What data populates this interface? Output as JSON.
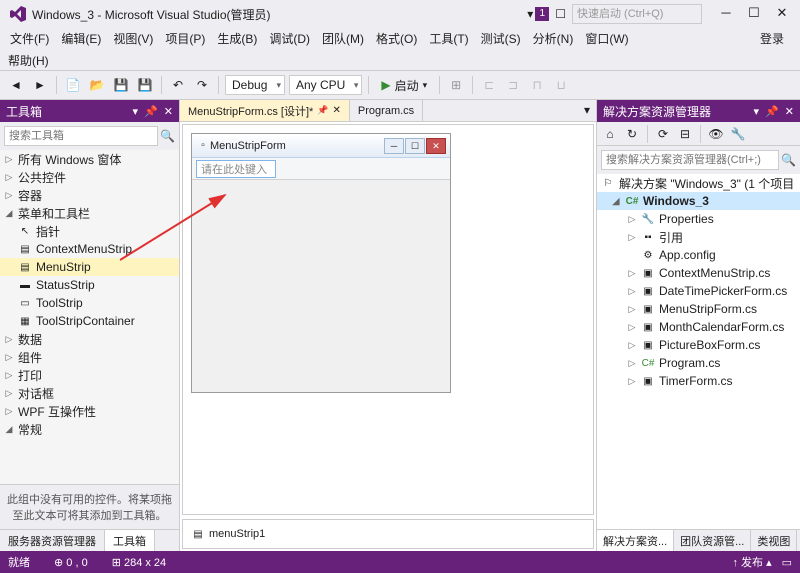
{
  "title": "Windows_3 - Microsoft Visual Studio(管理员)",
  "badge": "1",
  "quicklaunch_placeholder": "快速启动 (Ctrl+Q)",
  "login": "登录",
  "menu": {
    "file": "文件(F)",
    "edit": "编辑(E)",
    "view": "视图(V)",
    "project": "项目(P)",
    "build": "生成(B)",
    "debug": "调试(D)",
    "team": "团队(M)",
    "format": "格式(O)",
    "tools": "工具(T)",
    "test": "测试(S)",
    "analyze": "分析(N)",
    "window": "窗口(W)",
    "help": "帮助(H)"
  },
  "toolbar": {
    "config": "Debug",
    "platform": "Any CPU",
    "start": "启动"
  },
  "toolbox": {
    "title": "工具箱",
    "search_placeholder": "搜索工具箱",
    "groups": {
      "allwin": "所有 Windows 窗体",
      "common": "公共控件",
      "containers": "容器",
      "menus": "菜单和工具栏",
      "data": "数据",
      "components": "组件",
      "printing": "打印",
      "dialogs": "对话框",
      "wpf": "WPF 互操作性",
      "general": "常规"
    },
    "menus_items": {
      "pointer": "指针",
      "context": "ContextMenuStrip",
      "menu": "MenuStrip",
      "status": "StatusStrip",
      "tool": "ToolStrip",
      "container": "ToolStripContainer"
    },
    "note": "此组中没有可用的控件。将某项拖至此文本可将其添加到工具箱。",
    "tabs": {
      "server": "服务器资源管理器",
      "toolbox": "工具箱"
    }
  },
  "doc_tabs": {
    "active": "MenuStripForm.cs [设计]*",
    "other": "Program.cs"
  },
  "form": {
    "title": "MenuStripForm",
    "type_here": "请在此处键入"
  },
  "tray": {
    "item": "menuStrip1"
  },
  "solution": {
    "title": "解决方案资源管理器",
    "search_placeholder": "搜索解决方案资源管理器(Ctrl+;)",
    "root": "解决方案 \"Windows_3\" (1 个项目",
    "project": "Windows_3",
    "items": {
      "properties": "Properties",
      "references": "引用",
      "appconfig": "App.config",
      "context": "ContextMenuStrip.cs",
      "datetime": "DateTimePickerForm.cs",
      "menustrip": "MenuStripForm.cs",
      "monthcal": "MonthCalendarForm.cs",
      "picture": "PictureBoxForm.cs",
      "program": "Program.cs",
      "timer": "TimerForm.cs"
    },
    "tabs": {
      "sol": "解决方案资...",
      "team": "团队资源管...",
      "classview": "类视图"
    }
  },
  "status": {
    "ready": "就绪",
    "pos": "0 , 0",
    "size": "284 x 24",
    "publish": "发布"
  }
}
